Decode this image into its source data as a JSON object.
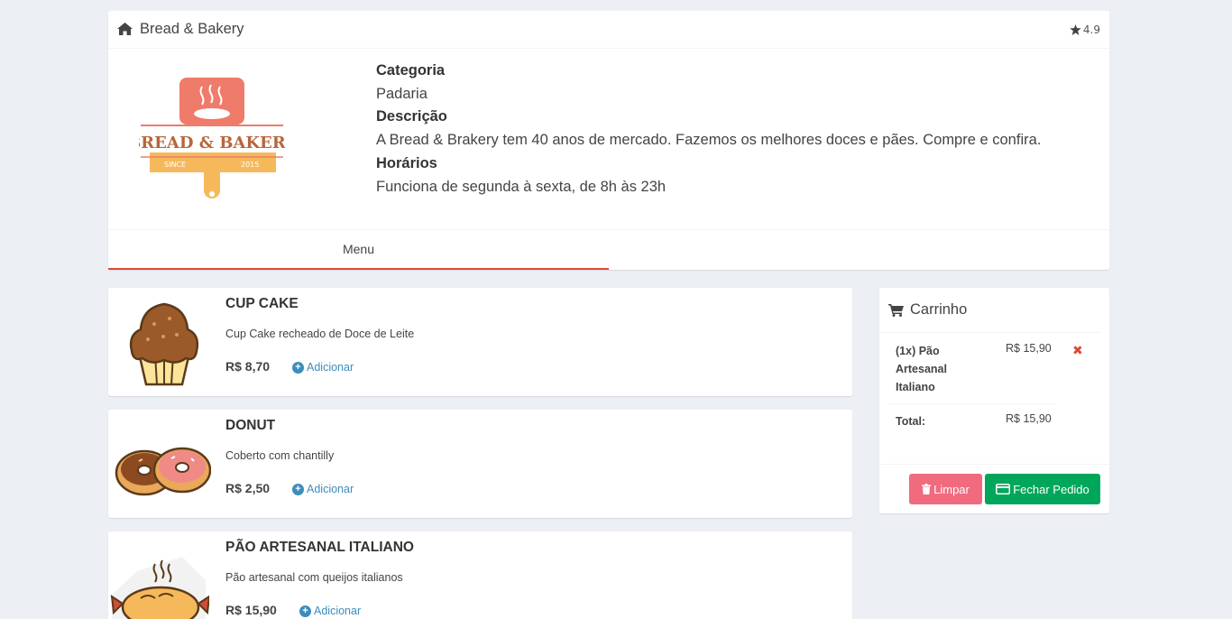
{
  "restaurant": {
    "name": "Bread & Bakery",
    "rating": "4.9",
    "logo_text": "BREAD & BAKERY",
    "logo_since": "SINCE",
    "logo_year": "2015",
    "category_label": "Categoria",
    "category": "Padaria",
    "description_label": "Descrição",
    "description": "A Bread & Brakery tem 40 anos de mercado. Fazemos os melhores doces e pães. Compre e confira.",
    "hours_label": "Horários",
    "hours": "Funciona de segunda à sexta, de 8h às 23h"
  },
  "tabs": [
    {
      "label": "Menu",
      "active": true
    }
  ],
  "menu": [
    {
      "name": "CUP CAKE",
      "description": "Cup Cake recheado de Doce de Leite",
      "price": "R$ 8,70",
      "add_label": "Adicionar",
      "icon": "cupcake-icon"
    },
    {
      "name": "DONUT",
      "description": "Coberto com chantilly",
      "price": "R$ 2,50",
      "add_label": "Adicionar",
      "icon": "donut-icon"
    },
    {
      "name": "PÃO ARTESANAL ITALIANO",
      "description": "Pão artesanal com queijos italianos",
      "price": "R$ 15,90",
      "add_label": "Adicionar",
      "icon": "bread-icon"
    }
  ],
  "cart": {
    "title": "Carrinho",
    "items": [
      {
        "name": "(1x) Pão Artesanal Italiano",
        "price": "R$ 15,90"
      }
    ],
    "total_label": "Total:",
    "total": "R$ 15,90",
    "clear_label": "Limpar",
    "checkout_label": "Fechar Pedido"
  },
  "colors": {
    "accent": "#dd4b39",
    "link": "#3c8dbc",
    "clear_button": "#f16b7f",
    "checkout_button": "#00a65a",
    "background": "#ecf0f5"
  }
}
